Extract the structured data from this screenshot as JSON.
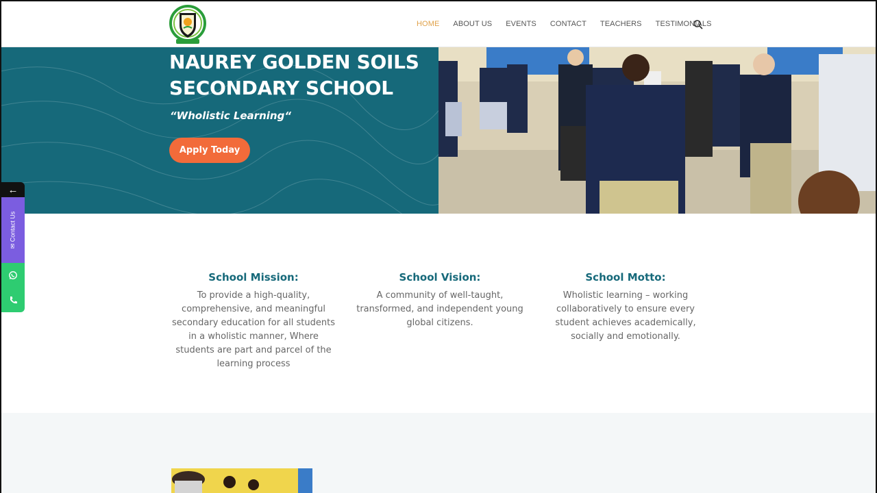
{
  "header": {
    "nav": [
      "HOME",
      "ABOUT US",
      "EVENTS",
      "CONTACT",
      "TEACHERS",
      "TESTIMONIALS"
    ],
    "active_item": "HOME",
    "accent_color": "#e0a24a",
    "search_icon": "search-icon"
  },
  "hero": {
    "title_line1": "NAUREY GOLDEN SOILS",
    "title_line2": "SECONDARY SCHOOL",
    "tagline": "“Wholistic Learning“",
    "apply_label": "Apply Today",
    "background_color": "#16697a",
    "button_color": "#f26b3a"
  },
  "side_widget": {
    "arrow": "←",
    "contact_label": "Contact Us",
    "icons": [
      "mail-icon",
      "whatsapp-icon",
      "phone-icon"
    ]
  },
  "info": [
    {
      "heading": "School Mission:",
      "text": "To provide a high-quality, comprehensive, and meaningful secondary education for all students in a wholistic manner, Where students are part and parcel of the learning process"
    },
    {
      "heading": "School Vision:",
      "text": "A community of well-taught, transformed, and independent young global citizens."
    },
    {
      "heading": "School Motto:",
      "text": "Wholistic learning – working collaboratively to ensure every student achieves academically, socially and emotionally."
    }
  ]
}
